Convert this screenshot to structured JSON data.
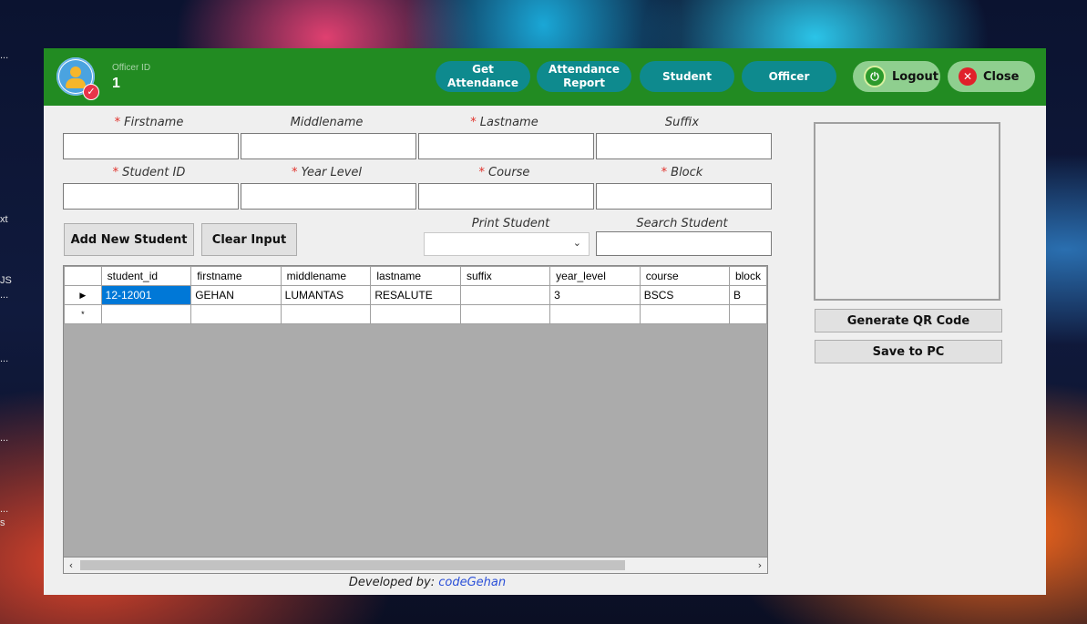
{
  "desktop": {
    "labels": [
      "...",
      "xt",
      "JS",
      "...",
      "...",
      "...",
      "...",
      "s"
    ]
  },
  "header": {
    "officer_label": "Officer ID",
    "officer_value": "1",
    "nav": [
      "Get Attendance",
      "Attendance Report",
      "Student",
      "Officer"
    ],
    "logout": "Logout",
    "close": "Close"
  },
  "form": {
    "firstname": "Firstname",
    "middlename": "Middlename",
    "lastname": "Lastname",
    "suffix": "Suffix",
    "student_id": "Student ID",
    "year_level": "Year Level",
    "course": "Course",
    "block": "Block",
    "required_mark": "*"
  },
  "actions": {
    "add": "Add New Student",
    "clear": "Clear Input",
    "print_label": "Print Student",
    "search_label": "Search Student"
  },
  "table": {
    "columns": [
      "student_id",
      "firstname",
      "middlename",
      "lastname",
      "suffix",
      "year_level",
      "course",
      "block"
    ],
    "rows": [
      [
        "12-12001",
        "GEHAN",
        "LUMANTAS",
        "RESALUTE",
        "",
        "3",
        "BSCS",
        "B"
      ]
    ],
    "new_row_marker": "*",
    "current_row_marker": "▶"
  },
  "side": {
    "generate_qr": "Generate QR Code",
    "save": "Save to PC"
  },
  "footer": {
    "prefix": "Developed by: ",
    "brand": "codeGehan"
  }
}
